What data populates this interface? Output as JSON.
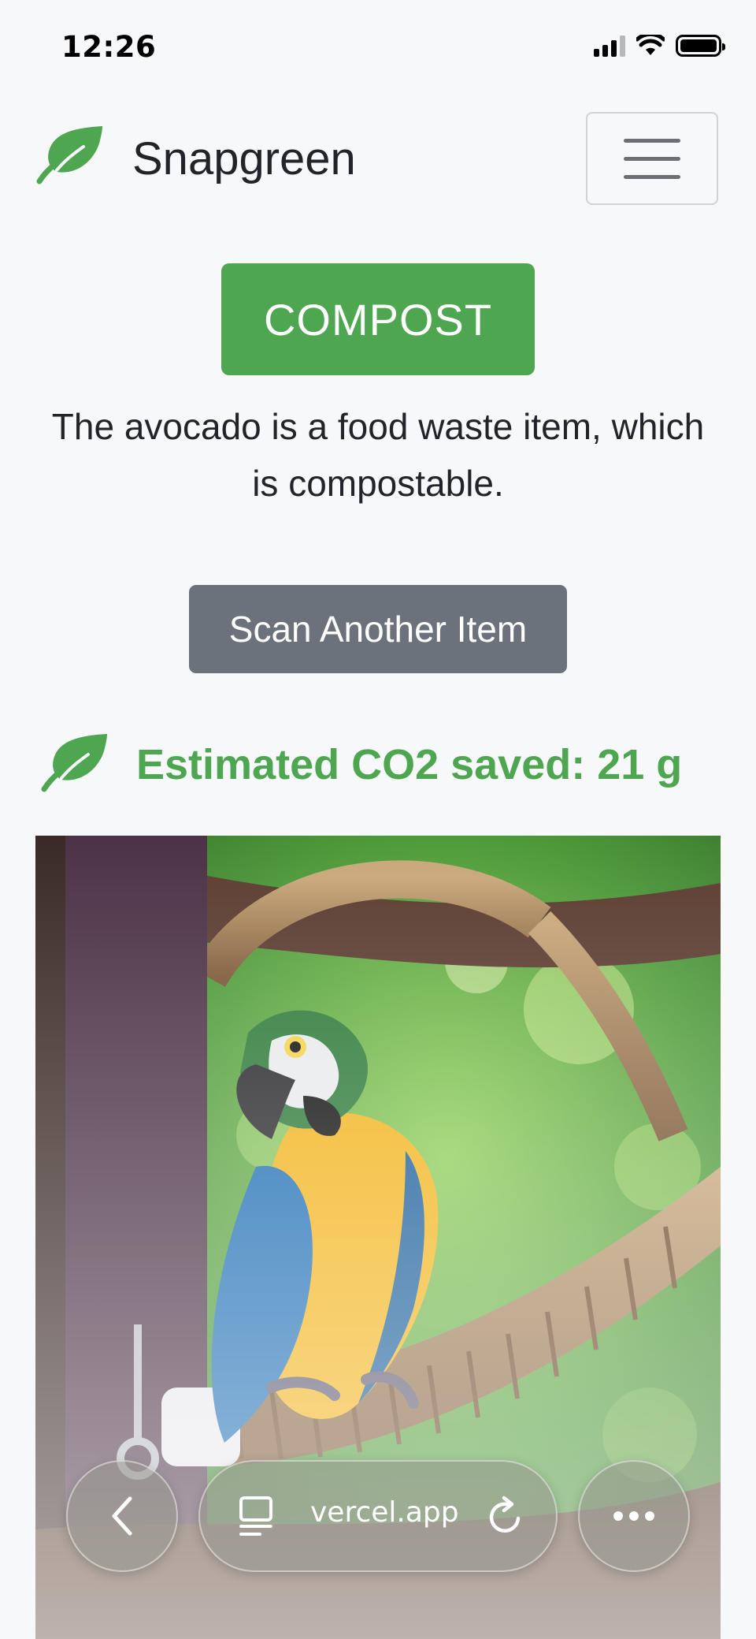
{
  "status": {
    "time": "12:26"
  },
  "navbar": {
    "brand": "Snapgreen"
  },
  "result": {
    "category": "COMPOST",
    "explanation": "The avocado is a food waste item, which is compostable.",
    "scan_again_label": "Scan Another Item",
    "co2_text": "Estimated CO2 saved: 21 g"
  },
  "browser": {
    "url": "vercel.app"
  },
  "colors": {
    "brand_green": "#4fa651",
    "secondary_gray": "#6c727b",
    "background": "#f7f8f9"
  },
  "icons": [
    "leaf-icon",
    "hamburger-icon",
    "back-icon",
    "tabs-icon",
    "reload-icon",
    "more-icon"
  ]
}
